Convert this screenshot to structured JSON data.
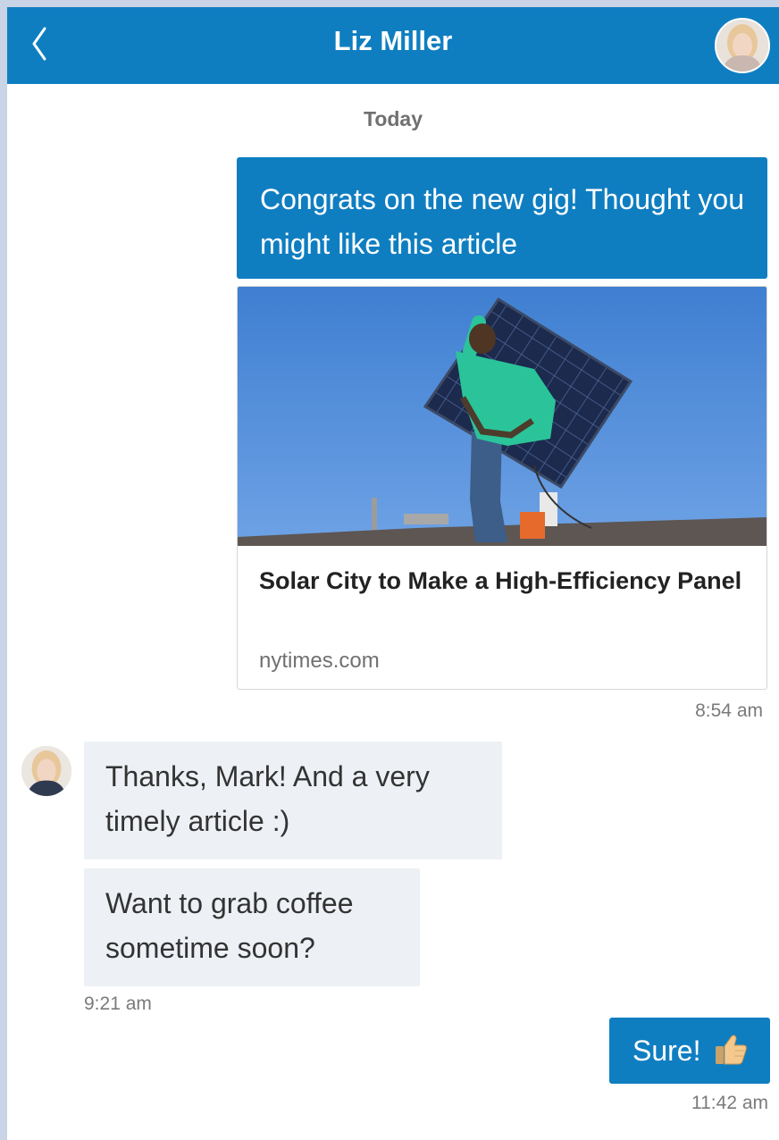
{
  "header": {
    "title": "Liz Miller",
    "back_icon": "chevron-left-icon",
    "avatar_icon": "avatar"
  },
  "conversation": {
    "day_label": "Today",
    "messages": [
      {
        "direction": "outgoing",
        "text": "Congrats on the new gig! Thought you might like this article",
        "attachment": {
          "title": "Solar City to Make a High-Efficiency Panel",
          "source": "nytimes.com"
        },
        "time": "8:54 am"
      },
      {
        "direction": "incoming",
        "text": "Thanks, Mark! And a very timely article :)"
      },
      {
        "direction": "incoming",
        "text": "Want to grab coffee sometime soon?",
        "time": "9:21 am"
      },
      {
        "direction": "outgoing",
        "text": "Sure!",
        "icon": "thumbs-up-icon",
        "time": "11:42 am"
      }
    ]
  },
  "colors": {
    "brand_blue": "#0f7ec1",
    "incoming_bubble": "#edf0f4",
    "outer_background": "#c9d4e6"
  }
}
